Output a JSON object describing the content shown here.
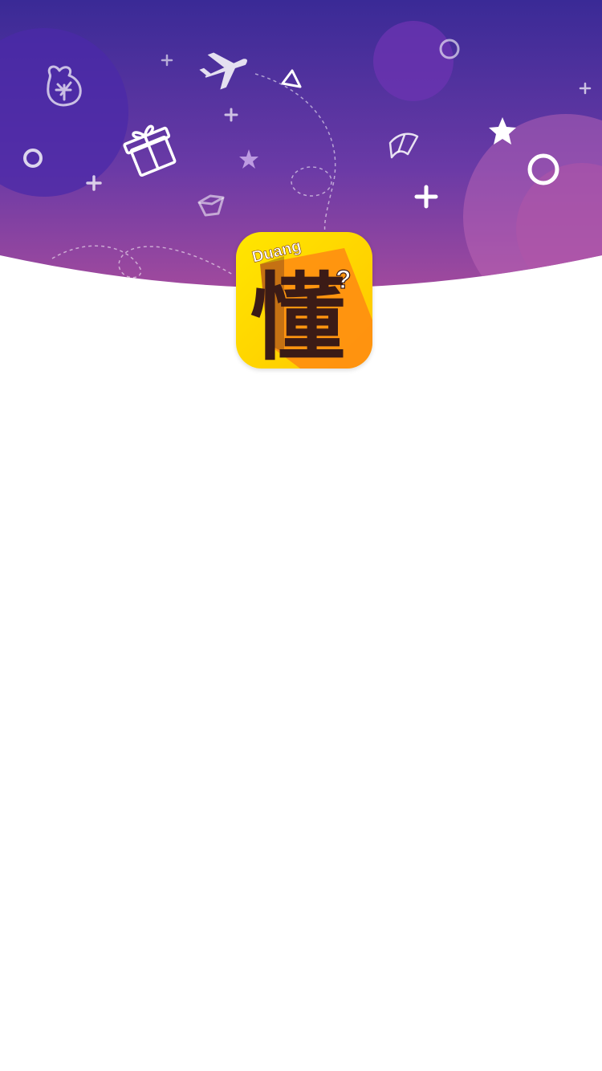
{
  "splash": {
    "logo": {
      "brand_text": "Duang",
      "glyph": "懂",
      "mark": "?"
    },
    "decorations": [
      "money-bag-icon",
      "gift-icon",
      "airplane-icon",
      "triangle-icon",
      "star-icon",
      "book-icon",
      "box-icon",
      "ring-icon",
      "plus-icon"
    ]
  },
  "colors": {
    "header_top": "#3a2a96",
    "header_bottom": "#a0499e",
    "logo_yellow": "#ffd400",
    "logo_orange": "#ff8a12",
    "glyph": "#3b1b16"
  }
}
